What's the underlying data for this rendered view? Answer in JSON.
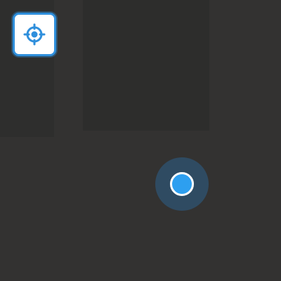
{
  "map": {
    "theme": "dark",
    "background_color": "#333231",
    "block_color": "#2c2c2b"
  },
  "controls": {
    "locate_button": {
      "icon": "crosshair-icon",
      "accent_color": "#2f8fdc"
    }
  },
  "user_location": {
    "marker": "current-location-dot",
    "dot_color": "#2d9ff0",
    "halo_color": "#2f4b62"
  }
}
